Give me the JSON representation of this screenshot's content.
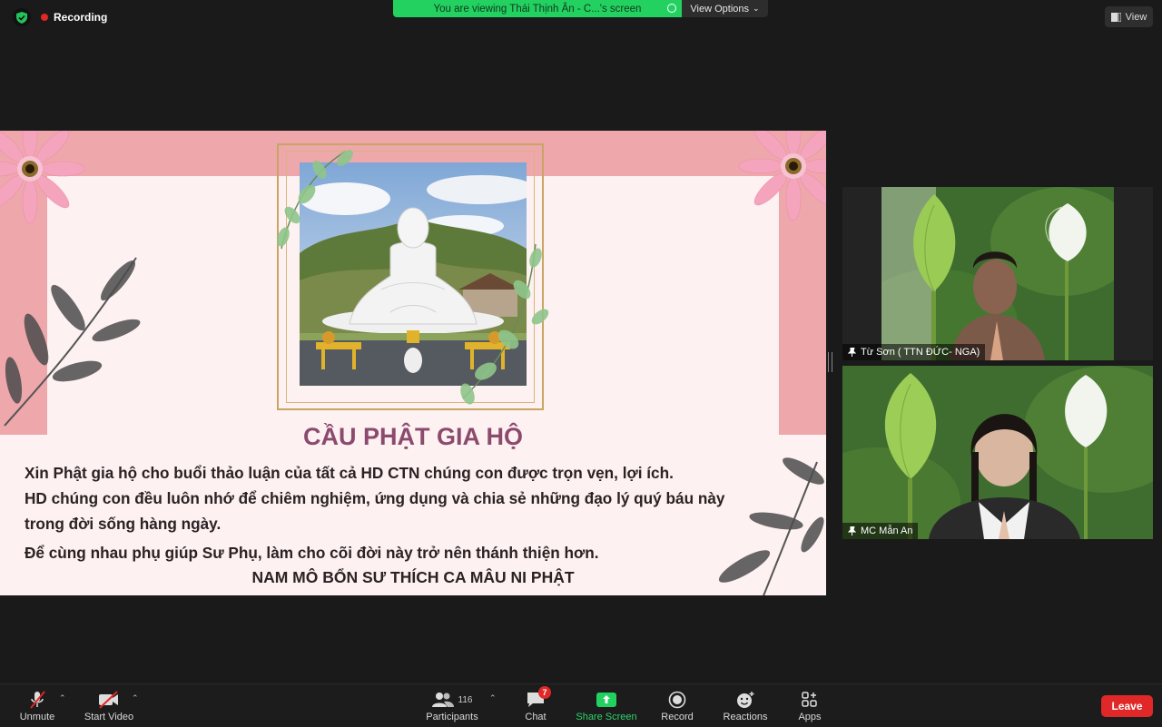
{
  "top": {
    "recording_label": "Recording",
    "viewing_banner": "You are viewing Thái Thịnh Ân - C...'s screen",
    "view_options_label": "View Options",
    "view_label": "View"
  },
  "slide": {
    "title": "CẦU PHẬT GIA HỘ",
    "lines": [
      "Xin Phật gia hộ cho buổi thảo luận của tất cả HD CTN chúng con được trọn vẹn, lợi ích.",
      "HD chúng con đều luôn nhớ để chiêm nghiệm, ứng dụng và chia sẻ những đạo lý quý báu này",
      "trong đời sống hàng ngày.",
      "Để cùng nhau phụ giúp Sư Phụ, làm cho cõi đời này trở nên thánh thiện hơn."
    ],
    "footer": "NAM MÔ BỔN SƯ THÍCH CA MÂU NI PHẬT"
  },
  "participants": [
    {
      "name": "Từ Sơn ( TTN ĐỨC- NGA)"
    },
    {
      "name": "MC Mẫn An"
    }
  ],
  "toolbar": {
    "unmute": "Unmute",
    "start_video": "Start Video",
    "participants": "Participants",
    "participants_count": "116",
    "chat": "Chat",
    "chat_badge": "7",
    "share_screen": "Share Screen",
    "record": "Record",
    "reactions": "Reactions",
    "apps": "Apps",
    "leave": "Leave"
  },
  "colors": {
    "share_green": "#23d160",
    "leave_red": "#e02828",
    "slide_pink": "#eea7ab",
    "title_purple": "#8b4a6e"
  }
}
